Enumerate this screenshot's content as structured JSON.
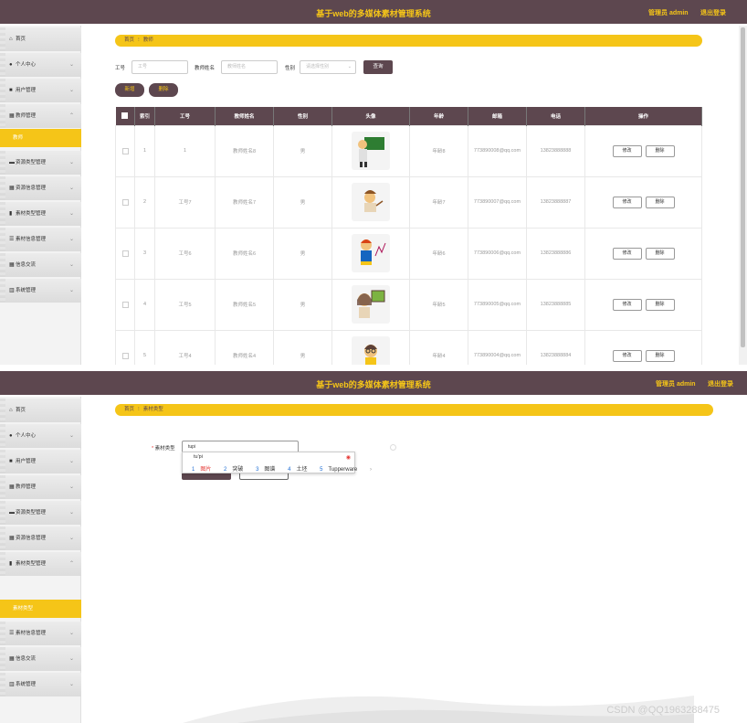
{
  "app_title": "基于web的多媒体素材管理系统",
  "admin_label": "管理员 admin",
  "logout_label": "退出登录",
  "nav": {
    "home": "首页",
    "profile": "个人中心",
    "user_mgmt": "用户管理",
    "teacher_mgmt": "教师管理",
    "teacher_sub": "教师",
    "resource_type_mgmt": "资源类型管理",
    "resource_info_mgmt": "资源信息管理",
    "material_type_mgmt": "素材类型管理",
    "material_type_sub": "素材类型",
    "material_info_mgmt": "素材信息管理",
    "info_exchange": "信息交流",
    "system_mgmt": "系统管理"
  },
  "page1": {
    "breadcrumb": {
      "home": "首页",
      "sep": "⁝",
      "current": "教师"
    },
    "search": {
      "id_label": "工号",
      "id_placeholder": "工号",
      "name_label": "教师姓名",
      "name_placeholder": "教师姓名",
      "gender_label": "性别",
      "gender_placeholder": "请选择性别",
      "search_button": "查询"
    },
    "add_button": "新增",
    "delete_button": "删除",
    "columns": [
      "",
      "索引",
      "工号",
      "教师姓名",
      "性别",
      "头像",
      "年龄",
      "邮箱",
      "电话",
      "操作"
    ],
    "edit_label": "修改",
    "row_delete_label": "删除",
    "rows": [
      {
        "index": "1",
        "id": "1",
        "name": "教师姓名8",
        "gender": "男",
        "age": "年龄8",
        "email": "773890008@qq.com",
        "phone": "13823888888"
      },
      {
        "index": "2",
        "id": "工号7",
        "name": "教师姓名7",
        "gender": "男",
        "age": "年龄7",
        "email": "773890007@qq.com",
        "phone": "13823888887"
      },
      {
        "index": "3",
        "id": "工号6",
        "name": "教师姓名6",
        "gender": "男",
        "age": "年龄6",
        "email": "773890006@qq.com",
        "phone": "13823888886"
      },
      {
        "index": "4",
        "id": "工号5",
        "name": "教师姓名5",
        "gender": "男",
        "age": "年龄5",
        "email": "773890005@qq.com",
        "phone": "13823888885"
      },
      {
        "index": "5",
        "id": "工号4",
        "name": "教师姓名4",
        "gender": "男",
        "age": "年龄4",
        "email": "773890004@qq.com",
        "phone": "13823888884"
      }
    ]
  },
  "page2": {
    "breadcrumb": {
      "home": "首页",
      "sep": "⁝",
      "current": "素材类型"
    },
    "form": {
      "required_mark": "*",
      "label": "素材类型",
      "value": "tupi"
    },
    "ime": {
      "typed": "tu'pi",
      "candidates": [
        {
          "num": "1",
          "text": "图片"
        },
        {
          "num": "2",
          "text": "突破"
        },
        {
          "num": "3",
          "text": "图谱"
        },
        {
          "num": "4",
          "text": "土坯"
        },
        {
          "num": "5",
          "text": "Tupperware"
        }
      ],
      "more": "›"
    },
    "watermark": "CSDN @QQ1963288475"
  },
  "colors": {
    "header": "#5d474f",
    "accent": "#f5c518"
  }
}
